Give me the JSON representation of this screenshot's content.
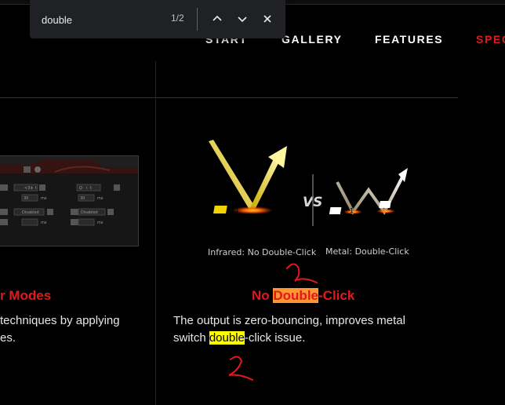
{
  "find_bar": {
    "query": "double",
    "match_count": "1/2",
    "icons": [
      "chevron-up-icon",
      "chevron-down-icon",
      "close-icon"
    ]
  },
  "nav": {
    "items": [
      {
        "label": "START"
      },
      {
        "label": "GALLERY"
      },
      {
        "label": "FEATURES"
      },
      {
        "label": "SPEC"
      }
    ],
    "active_color": "#e0191d"
  },
  "left_feature": {
    "title_partial": "r Modes",
    "desc_line1": "techniques by applying",
    "desc_line2": "es."
  },
  "left_panel": {
    "labels": [
      "<3>",
      "i",
      "t",
      "Q",
      "i",
      "t",
      "30",
      "ms",
      "30",
      "ms",
      "Disabled",
      "Disabled",
      "ms",
      "ms"
    ]
  },
  "compare_graphic": {
    "vs_label": "VS",
    "caption_left": "Infrared: No Double-Click",
    "caption_right": "Metal: Double-Click",
    "badges": [
      "1",
      "1",
      "2"
    ]
  },
  "right_feature": {
    "title_before": "No ",
    "title_match": "Double",
    "title_after": "-Click",
    "desc_line1": "The output is zero-bouncing, improves metal",
    "desc_line2_before": "switch ",
    "desc_line2_match": "double",
    "desc_line2_after": "-click issue."
  },
  "annotations": {
    "mark_1": "1",
    "mark_2": "2",
    "color": "#e0191d"
  },
  "colors": {
    "accent_red": "#e0191d",
    "current_match": "#ff9632",
    "other_match": "#ffff00",
    "background": "#000000"
  }
}
